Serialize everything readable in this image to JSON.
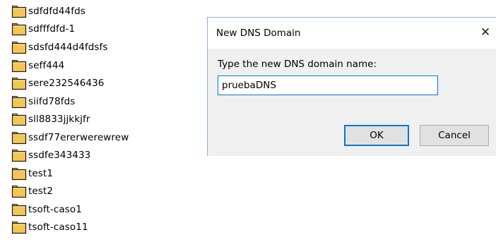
{
  "folders": [
    {
      "label": "sdfdfd44fds",
      "icon": "folder-icon"
    },
    {
      "label": "sdfffdfd-1",
      "icon": "folder-icon"
    },
    {
      "label": "sdsfd444d4fdsfs",
      "icon": "folder-icon"
    },
    {
      "label": "seff444",
      "icon": "folder-icon"
    },
    {
      "label": "sere232546436",
      "icon": "folder-icon"
    },
    {
      "label": "siifd78fds",
      "icon": "folder-icon"
    },
    {
      "label": "sll8833jjkkjfr",
      "icon": "folder-icon"
    },
    {
      "label": "ssdf77ererwerewrew",
      "icon": "folder-icon"
    },
    {
      "label": "ssdfe343433",
      "icon": "folder-icon"
    },
    {
      "label": "test1",
      "icon": "folder-icon"
    },
    {
      "label": "test2",
      "icon": "folder-icon"
    },
    {
      "label": "tsoft-caso1",
      "icon": "folder-icon"
    },
    {
      "label": "tsoft-caso11",
      "icon": "folder-icon"
    }
  ],
  "dialog": {
    "title": "New DNS Domain",
    "close_glyph": "✕",
    "prompt": "Type the new DNS domain name:",
    "input_value": "pruebaDNS",
    "ok_label": "OK",
    "cancel_label": "Cancel"
  },
  "colors": {
    "folder_fill": "#f3c654",
    "folder_outline": "#1a1a1a",
    "dialog_border": "#8fb3de",
    "dialog_body": "#f0f0f0",
    "accent": "#0078d7",
    "button_face": "#e1e1e1"
  }
}
